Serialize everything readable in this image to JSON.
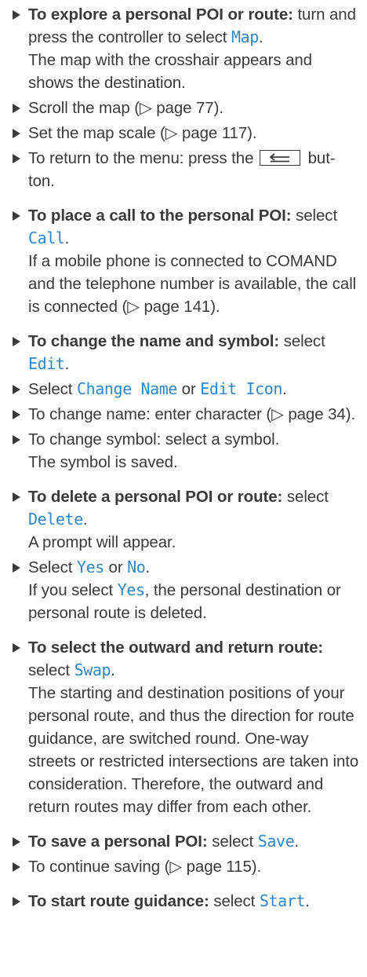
{
  "items": {
    "map_head": "To explore a personal POI or route:",
    "map_pre": " turn and press the controller to select ",
    "map_btn": "Map",
    "map_post": ".",
    "map_result": "The map with the crosshair appears and shows the destination.",
    "scroll_text": "Scroll the map (▷ page 77).",
    "scale_text": "Set the map scale (▷ page 117).",
    "return_pre": "To return to the menu: press the",
    "return_post": "but-ton.",
    "back_key_icon": "back-arrow-icon",
    "call_head": "To place a call to the personal POI:",
    "call_pre": " select ",
    "call_btn": "Call",
    "call_post": ".",
    "call_result": "If a mobile phone is connected to COMAND and the telephone number is available, the call is connected (▷ page 141).",
    "edit_head": "To change the name and symbol:",
    "edit_pre": " select ",
    "edit_btn": "Edit",
    "edit_post": ".",
    "select_word": "Select ",
    "change_name_btn": "Change Name",
    "or_word_1": " or ",
    "edit_icon_btn": "Edit Icon",
    "select_post": ".",
    "name_text": "To change name: enter character (▷ page 34).",
    "symbol_text": "To change symbol: select a symbol.",
    "symbol_result": "The symbol is saved.",
    "delete_head": "To delete a personal POI or route:",
    "delete_pre": " select ",
    "delete_btn": "Delete",
    "delete_post": ".",
    "delete_result": "A prompt will appear.",
    "yes_select_word": "Select ",
    "yes_btn": "Yes",
    "or_word_2": " or ",
    "no_btn": "No",
    "yes_post": ".",
    "yes_result_pre": "If you select ",
    "yes_result_btn": "Yes",
    "yes_result_post": ", the personal destination or personal route is deleted.",
    "swap_head": "To select the outward and return route:",
    "swap_pre": " select ",
    "swap_btn": "Swap",
    "swap_post": ".",
    "swap_result": "The starting and destination positions of your personal route, and thus the direction for route guidance, are switched round. One-way streets or restricted intersections are taken into consideration. Therefore, the outward and return routes may differ from each other.",
    "save_head": "To save a personal POI:",
    "save_pre": " select ",
    "save_btn": "Save",
    "save_post": ".",
    "continue_text": "To continue saving (▷ page 115).",
    "start_head": "To start route guidance:",
    "start_pre": " select ",
    "start_btn": "Start",
    "start_post": "."
  }
}
